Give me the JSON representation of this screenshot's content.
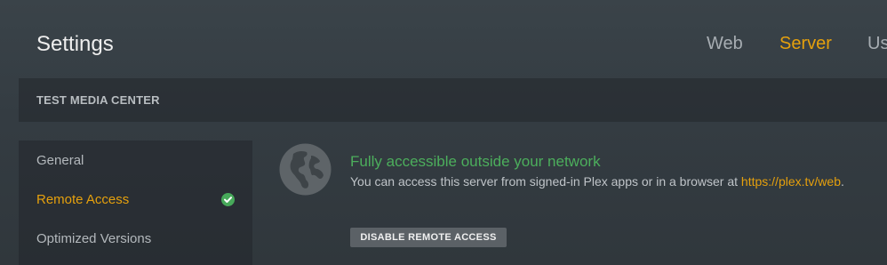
{
  "header": {
    "title": "Settings",
    "tabs": [
      {
        "label": "Web",
        "active": false
      },
      {
        "label": "Server",
        "active": true
      },
      {
        "label": "Users",
        "active": false
      }
    ]
  },
  "server": {
    "name": "TEST MEDIA CENTER"
  },
  "sidebar": {
    "items": [
      {
        "label": "General",
        "active": false
      },
      {
        "label": "Remote Access",
        "active": true,
        "status_icon": "check-icon"
      },
      {
        "label": "Optimized Versions",
        "active": false
      }
    ]
  },
  "remote_access": {
    "status_icon": "globe-icon",
    "status_title": "Fully accessible outside your network",
    "description_prefix": "You can access this server from signed-in Plex apps or in a browser at ",
    "link_text": "https://plex.tv/web",
    "description_suffix": ".",
    "disable_button_label": "DISABLE REMOTE ACCESS"
  },
  "colors": {
    "accent": "#e5a00d",
    "success": "#4cae5c",
    "background": "#3a4349"
  }
}
